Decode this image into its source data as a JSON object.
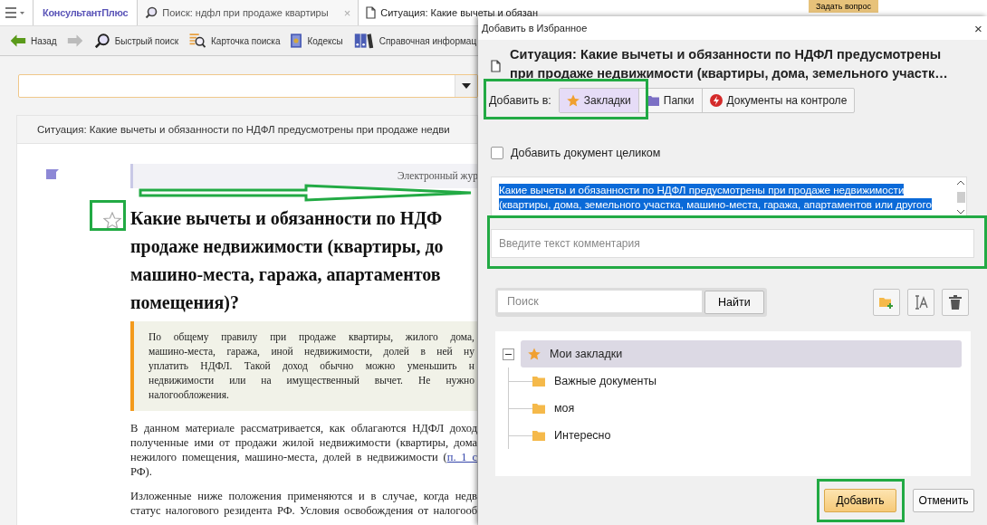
{
  "app": {
    "logo": "КонсультантПлюс",
    "tabs": [
      {
        "kind": "search",
        "label": "Поиск: ндфл при продаже квартиры",
        "close": "×",
        "selected": false
      },
      {
        "kind": "document",
        "label": "Ситуация: Какие вычеты и обязан",
        "selected": true
      }
    ],
    "ask_button": "Задать вопрос",
    "toolbar": [
      {
        "kind": "back",
        "label": "Назад",
        "disabled": false
      },
      {
        "kind": "forward",
        "disabled": true
      },
      {
        "kind": "quick-search",
        "label": "Быстрый поиск",
        "disabled": false
      },
      {
        "kind": "search-card",
        "label": "Карточка поиска",
        "disabled": false
      },
      {
        "kind": "codes",
        "label": "Кодексы",
        "disabled": false
      },
      {
        "kind": "reference",
        "label": "Справочная информац",
        "disabled": false
      }
    ]
  },
  "breadcrumb": "Ситуация: Какие вычеты и обязанности по НДФЛ предусмотрены при продаже недви",
  "document": {
    "banner": "Электронный жур",
    "bookmarked": false,
    "title_lines": [
      "Какие вычеты и обязанности по НДФ",
      "продаже недвижимости (квартиры, до",
      "машино-места, гаража, апартаментов",
      "помещения)?"
    ],
    "summary_lines": [
      "По общему правилу при продаже квартиры, жилого дома,",
      "машино-места, гаража, иной недвижимости, долей в ней ну",
      "уплатить НДФЛ. Такой доход обычно можно уменьшить н",
      "недвижимости или на имущественный вычет. Не нужно",
      "налогообложения."
    ],
    "paragraphs": [
      [
        {
          "text": "В данном материале рассматривается, как облагаются НДФЛ доход"
        },
        {
          "text": "полученные ими от продажи жилой недвижимости (квартиры, дома"
        },
        {
          "text": "нежилого помещения, машино-места, долей в недвижимости (",
          "link": "п. 1 с"
        },
        {
          "text": "РФ)."
        }
      ],
      [
        {
          "text": "Изложенные ниже положения применяются и в случае, когда недв"
        },
        {
          "text": "статус налогового резидента РФ. Условия освобождения от налогооб"
        }
      ]
    ]
  },
  "dialog": {
    "title": "Добавить в Избранное",
    "close": "×",
    "doc_title_lines": [
      "Ситуация: Какие вычеты и обязанности по НДФЛ предусмотрены",
      "при продаже недвижимости (квартиры, дома, земельного участк…"
    ],
    "add_to_label": "Добавить в:",
    "targets": [
      {
        "kind": "bookmarks",
        "label": "Закладки",
        "selected": true
      },
      {
        "kind": "folders",
        "label": "Папки",
        "selected": false
      },
      {
        "kind": "control",
        "label": "Документы на контроле",
        "selected": false
      }
    ],
    "whole_document": {
      "label": "Добавить документ целиком",
      "checked": false
    },
    "excerpt": {
      "selected": true,
      "lines": [
        "Какие вычеты и обязанности по НДФЛ предусмотрены при продаже недвижимости",
        "(квартиры, дома, земельного участка, машино-места, гаража, апартаментов или другого"
      ]
    },
    "comment": {
      "placeholder": "Введите текст комментария"
    },
    "filter": {
      "placeholder": "Поиск",
      "button": "Найти"
    },
    "tools": [
      {
        "kind": "new-folder"
      },
      {
        "kind": "rename"
      },
      {
        "kind": "delete"
      }
    ],
    "tree": [
      {
        "kind": "bookmarks",
        "label": "Мои закладки",
        "expanded": true,
        "selected": true,
        "children": [
          {
            "kind": "folder",
            "label": "Важные документы",
            "selected": false
          },
          {
            "kind": "folder",
            "label": "моя",
            "selected": false
          },
          {
            "kind": "folder",
            "label": "Интересно",
            "selected": false
          }
        ]
      }
    ],
    "buttons": [
      {
        "kind": "primary",
        "label": "Добавить"
      },
      {
        "kind": "secondary",
        "label": "Отменить"
      }
    ]
  }
}
